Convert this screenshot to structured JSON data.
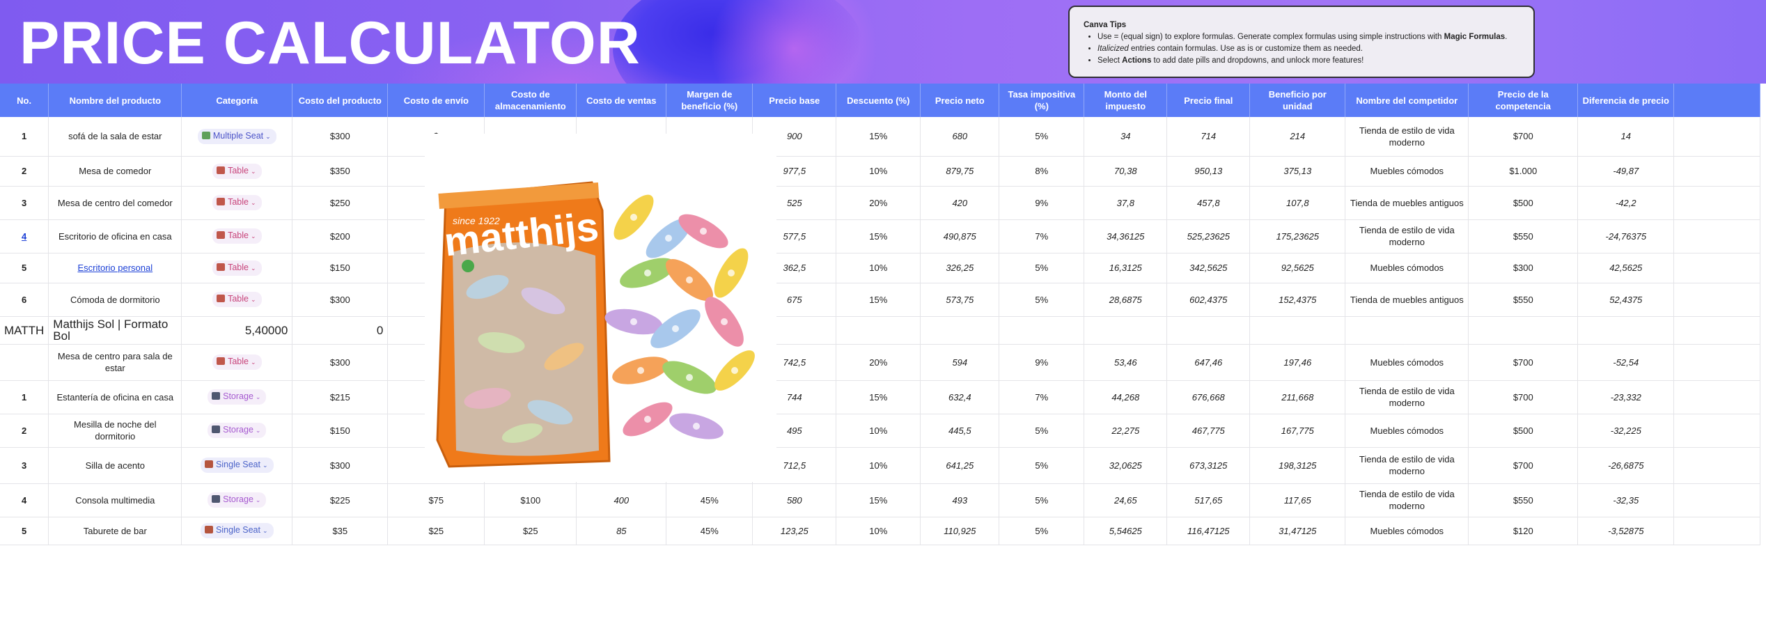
{
  "banner": {
    "title": "PRICE CALCULATOR"
  },
  "tips": {
    "heading": "Canva Tips",
    "items": [
      {
        "pre": "Use = (equal sign) to explore formulas. Generate complex formulas using simple instructions with ",
        "bold": "Magic Formulas",
        "post": "."
      },
      {
        "italic": "Italicized",
        "post": " entries contain formulas. Use as is or customize them as needed."
      },
      {
        "pre": "Select ",
        "bold": "Actions",
        "post": " to add date pills and dropdowns, and unlock more features!"
      }
    ]
  },
  "headers": [
    "No.",
    "Nombre del producto",
    "Categoría",
    "Costo del producto",
    "Costo de envío",
    "Costo de almacenamiento",
    "Costo de ventas",
    "Margen de beneficio (%)",
    "Precio base",
    "Descuento (%)",
    "Precio neto",
    "Tasa impositiva (%)",
    "Monto del impuesto",
    "Precio final",
    "Beneficio por unidad",
    "Nombre del competidor",
    "Precio de la competencia",
    "Diferencia de precio"
  ],
  "rows": [
    {
      "no": "1",
      "name": "sofá de la sala de estar",
      "cat": "Multiple Seat",
      "cat_kind": "multi",
      "cost": "$300",
      "ship": "$",
      "store": "",
      "sales": "",
      "margin": "",
      "base": "900",
      "disc": "15%",
      "net": "680",
      "tax": "5%",
      "taxamt": "34",
      "final": "714",
      "profit": "214",
      "comp": "Tienda de estilo de vida moderno",
      "compprice": "$700",
      "diff": "14"
    },
    {
      "no": "2",
      "name": "Mesa de comedor",
      "cat": "Table",
      "cat_kind": "table",
      "cost": "$350",
      "ship": "$",
      "store": "",
      "sales": "",
      "margin": "",
      "base": "977,5",
      "disc": "10%",
      "net": "879,75",
      "tax": "8%",
      "taxamt": "70,38",
      "final": "950,13",
      "profit": "375,13",
      "comp": "Muebles cómodos",
      "compprice": "$1.000",
      "diff": "-49,87"
    },
    {
      "no": "3",
      "name": "Mesa de centro del comedor",
      "cat": "Table",
      "cat_kind": "table",
      "cost": "$250",
      "ship": "$",
      "store": "",
      "sales": "",
      "margin": "",
      "base": "525",
      "disc": "20%",
      "net": "420",
      "tax": "9%",
      "taxamt": "37,8",
      "final": "457,8",
      "profit": "107,8",
      "comp": "Tienda de muebles antiguos",
      "compprice": "$500",
      "diff": "-42,2"
    },
    {
      "no": "4",
      "no_link": true,
      "name": "Escritorio de oficina en casa",
      "cat": "Table",
      "cat_kind": "table",
      "cost": "$200",
      "ship": "$",
      "store": "",
      "sales": "",
      "margin": "",
      "base": "577,5",
      "disc": "15%",
      "net": "490,875",
      "tax": "7%",
      "taxamt": "34,36125",
      "final": "525,23625",
      "profit": "175,23625",
      "comp": "Tienda de estilo de vida moderno",
      "compprice": "$550",
      "diff": "-24,76375"
    },
    {
      "no": "5",
      "name": "Escritorio personal",
      "name_link": true,
      "cat": "Table",
      "cat_kind": "table",
      "cost": "$150",
      "ship": "$",
      "store": "",
      "sales": "",
      "margin": "",
      "base": "362,5",
      "disc": "10%",
      "net": "326,25",
      "tax": "5%",
      "taxamt": "16,3125",
      "final": "342,5625",
      "profit": "92,5625",
      "comp": "Muebles cómodos",
      "compprice": "$300",
      "diff": "42,5625"
    },
    {
      "no": "6",
      "name": "Cómoda de dormitorio",
      "cat": "Table",
      "cat_kind": "table",
      "cost": "$300",
      "ship": "$",
      "store": "",
      "sales": "",
      "margin": "",
      "base": "675",
      "disc": "15%",
      "net": "573,75",
      "tax": "5%",
      "taxamt": "28,6875",
      "final": "602,4375",
      "profit": "152,4375",
      "comp": "Tienda de muebles antiguos",
      "compprice": "$550",
      "diff": "52,4375"
    },
    {
      "special": true,
      "no": "MATTH",
      "name": "Matthijs Sol | Formato Bol",
      "cat": "5,40000",
      "cost": "0"
    },
    {
      "no": "",
      "name": "Mesa de centro para sala de estar",
      "cat": "Table",
      "cat_kind": "table",
      "cost": "$300",
      "ship": "$",
      "store": "",
      "sales": "",
      "margin": "",
      "base": "742,5",
      "disc": "20%",
      "net": "594",
      "tax": "9%",
      "taxamt": "53,46",
      "final": "647,46",
      "profit": "197,46",
      "comp": "Muebles cómodos",
      "compprice": "$700",
      "diff": "-52,54"
    },
    {
      "no": "1",
      "name": "Estantería de oficina en casa",
      "cat": "Storage",
      "cat_kind": "storage",
      "cost": "$215",
      "ship": "$",
      "store": "",
      "sales": "",
      "margin": "",
      "base": "744",
      "disc": "15%",
      "net": "632,4",
      "tax": "7%",
      "taxamt": "44,268",
      "final": "676,668",
      "profit": "211,668",
      "comp": "Tienda de estilo de vida moderno",
      "compprice": "$700",
      "diff": "-23,332"
    },
    {
      "no": "2",
      "name": "Mesilla de noche del dormitorio",
      "cat": "Storage",
      "cat_kind": "storage",
      "cost": "$150",
      "ship": "$",
      "store": "",
      "sales": "",
      "margin": "",
      "base": "495",
      "disc": "10%",
      "net": "445,5",
      "tax": "5%",
      "taxamt": "22,275",
      "final": "467,775",
      "profit": "167,775",
      "comp": "Muebles cómodos",
      "compprice": "$500",
      "diff": "-32,225"
    },
    {
      "no": "3",
      "name": "Silla de acento",
      "cat": "Single Seat",
      "cat_kind": "single",
      "cost": "$300",
      "ship": "$",
      "store": "",
      "sales": "",
      "margin": "",
      "base": "712,5",
      "disc": "10%",
      "net": "641,25",
      "tax": "5%",
      "taxamt": "32,0625",
      "final": "673,3125",
      "profit": "198,3125",
      "comp": "Tienda de estilo de vida moderno",
      "compprice": "$700",
      "diff": "-26,6875"
    },
    {
      "no": "4",
      "name": "Consola multimedia",
      "cat": "Storage",
      "cat_kind": "storage",
      "cost": "$225",
      "ship": "$75",
      "store": "$100",
      "sales": "400",
      "margin": "45%",
      "base": "580",
      "disc": "15%",
      "net": "493",
      "tax": "5%",
      "taxamt": "24,65",
      "final": "517,65",
      "profit": "117,65",
      "comp": "Tienda de estilo de vida moderno",
      "compprice": "$550",
      "diff": "-32,35"
    },
    {
      "no": "5",
      "name": "Taburete de bar",
      "cat": "Single Seat",
      "cat_kind": "single",
      "cost": "$35",
      "ship": "$25",
      "store": "$25",
      "sales": "85",
      "margin": "45%",
      "base": "123,25",
      "disc": "10%",
      "net": "110,925",
      "tax": "5%",
      "taxamt": "5,54625",
      "final": "116,47125",
      "profit": "31,47125",
      "comp": "Muebles cómodos",
      "compprice": "$120",
      "diff": "-3,52875"
    }
  ],
  "product_image": {
    "brand": "matthijs",
    "tagline": "since 1922"
  }
}
